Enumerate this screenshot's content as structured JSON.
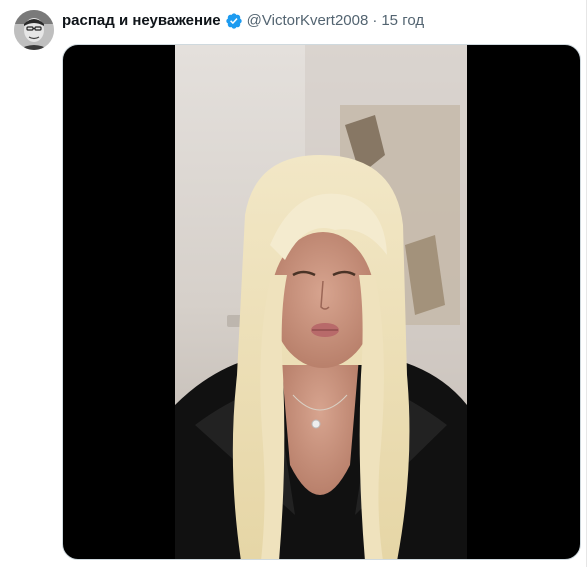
{
  "tweet": {
    "display_name": "распад и неуважение",
    "handle": "@VictorKvert2008",
    "separator": "·",
    "time": "15 год",
    "verified_icon": "verified-badge-icon",
    "colors": {
      "verified": "#1d9bf0",
      "name": "#0f1419",
      "secondary": "#536471"
    }
  }
}
